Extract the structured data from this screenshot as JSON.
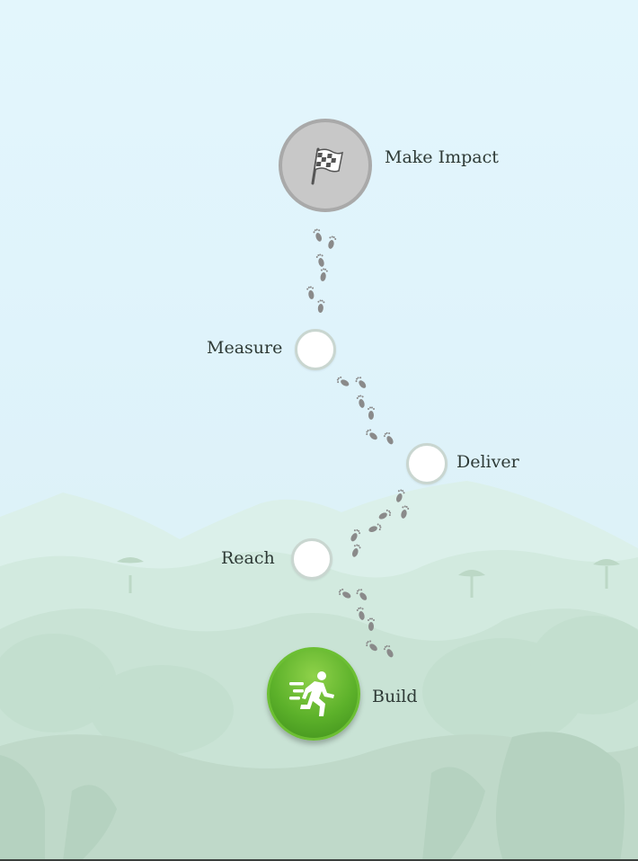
{
  "journey": {
    "stages": [
      {
        "id": "make-impact",
        "label": "Make Impact",
        "state": "goal",
        "icon": "checkered-flag-icon"
      },
      {
        "id": "measure",
        "label": "Measure",
        "state": "locked"
      },
      {
        "id": "deliver",
        "label": "Deliver",
        "state": "locked"
      },
      {
        "id": "reach",
        "label": "Reach",
        "state": "locked"
      },
      {
        "id": "build",
        "label": "Build",
        "state": "current",
        "icon": "running-person-icon"
      }
    ]
  },
  "colors": {
    "sky": "#e3f6fc",
    "current_green": "#5cb12a",
    "goal_gray": "#c8c8c8",
    "footprint": "#8a8a8a"
  }
}
